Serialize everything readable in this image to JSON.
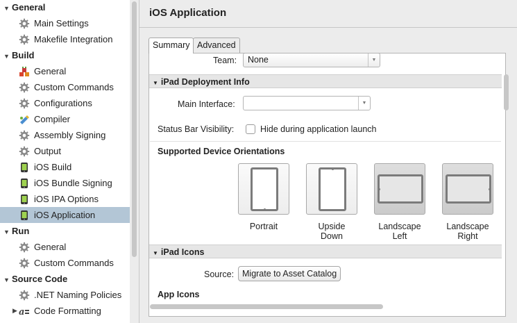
{
  "sidebar": {
    "sections": [
      {
        "label": "General",
        "expanded": true
      },
      {
        "label": "Build",
        "expanded": true
      },
      {
        "label": "Run",
        "expanded": true
      },
      {
        "label": "Source Code",
        "expanded": true
      }
    ],
    "items": [
      {
        "label": "Main Settings",
        "icon": "gear-icon"
      },
      {
        "label": "Makefile Integration",
        "icon": "gear-icon"
      },
      {
        "label": "General",
        "icon": "build-blocks-icon"
      },
      {
        "label": "Custom Commands",
        "icon": "gear-icon"
      },
      {
        "label": "Configurations",
        "icon": "gear-icon"
      },
      {
        "label": "Compiler",
        "icon": "compiler-icon"
      },
      {
        "label": "Assembly Signing",
        "icon": "gear-icon"
      },
      {
        "label": "Output",
        "icon": "gear-icon"
      },
      {
        "label": "iOS Build",
        "icon": "ios-device-icon"
      },
      {
        "label": "iOS Bundle Signing",
        "icon": "ios-device-icon"
      },
      {
        "label": "iOS IPA Options",
        "icon": "ios-device-icon"
      },
      {
        "label": "iOS Application",
        "icon": "ios-device-icon",
        "selected": true
      },
      {
        "label": "General",
        "icon": "gear-icon"
      },
      {
        "label": "Custom Commands",
        "icon": "gear-icon"
      },
      {
        "label": ".NET Naming Policies",
        "icon": "gear-icon"
      },
      {
        "label": "Code Formatting",
        "icon": "code-formatting-icon"
      }
    ]
  },
  "main": {
    "title": "iOS Application",
    "tabs": [
      {
        "label": "Summary",
        "active": true
      },
      {
        "label": "Advanced",
        "active": false
      }
    ],
    "team": {
      "label": "Team:",
      "value": "None"
    },
    "ipad_deployment": {
      "header": "iPad Deployment Info",
      "main_interface_label": "Main Interface:",
      "main_interface_value": "",
      "status_bar_label": "Status Bar Visibility:",
      "hide_status_bar_label": "Hide during application launch",
      "hide_status_bar_checked": false,
      "orientations_title": "Supported Device Orientations",
      "orientations": [
        {
          "label_1": "Portrait",
          "label_2": "",
          "selected": false
        },
        {
          "label_1": "Upside",
          "label_2": "Down",
          "selected": false
        },
        {
          "label_1": "Landscape",
          "label_2": "Left",
          "selected": true
        },
        {
          "label_1": "Landscape",
          "label_2": "Right",
          "selected": true
        }
      ]
    },
    "ipad_icons": {
      "header": "iPad Icons",
      "source_label": "Source:",
      "migrate_button": "Migrate to Asset Catalog",
      "app_icons_title": "App Icons"
    }
  },
  "colors": {
    "selection": "#b3c6d6",
    "section_bar": "#e6e6e6",
    "panel": "#ffffff",
    "chrome": "#ececec"
  }
}
